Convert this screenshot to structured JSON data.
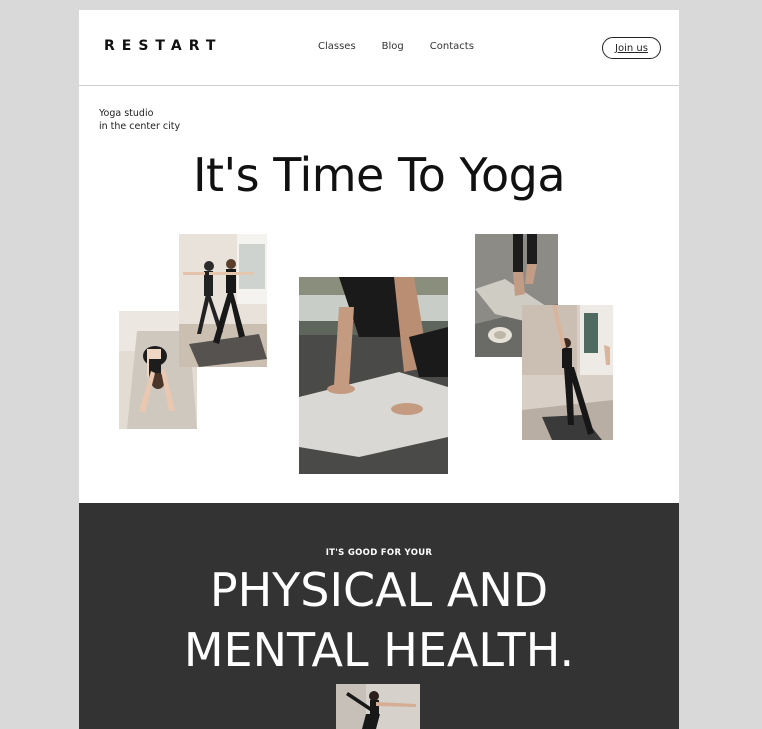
{
  "header": {
    "logo": "RESTART",
    "nav": [
      "Classes",
      "Blog",
      "Contacts"
    ],
    "join_label": "Join us"
  },
  "hero": {
    "tagline_line1": "Yoga studio",
    "tagline_line2": "in the center city",
    "title": "It's Time To Yoga"
  },
  "benefits": {
    "eyebrow": "IT'S GOOD FOR YOUR",
    "line1": "PHYSICAL AND",
    "line2": "MENTAL HEALTH."
  },
  "colors": {
    "page_bg": "#d9d9d9",
    "content_bg": "#ffffff",
    "dark_section": "#333333",
    "text": "#111111"
  }
}
